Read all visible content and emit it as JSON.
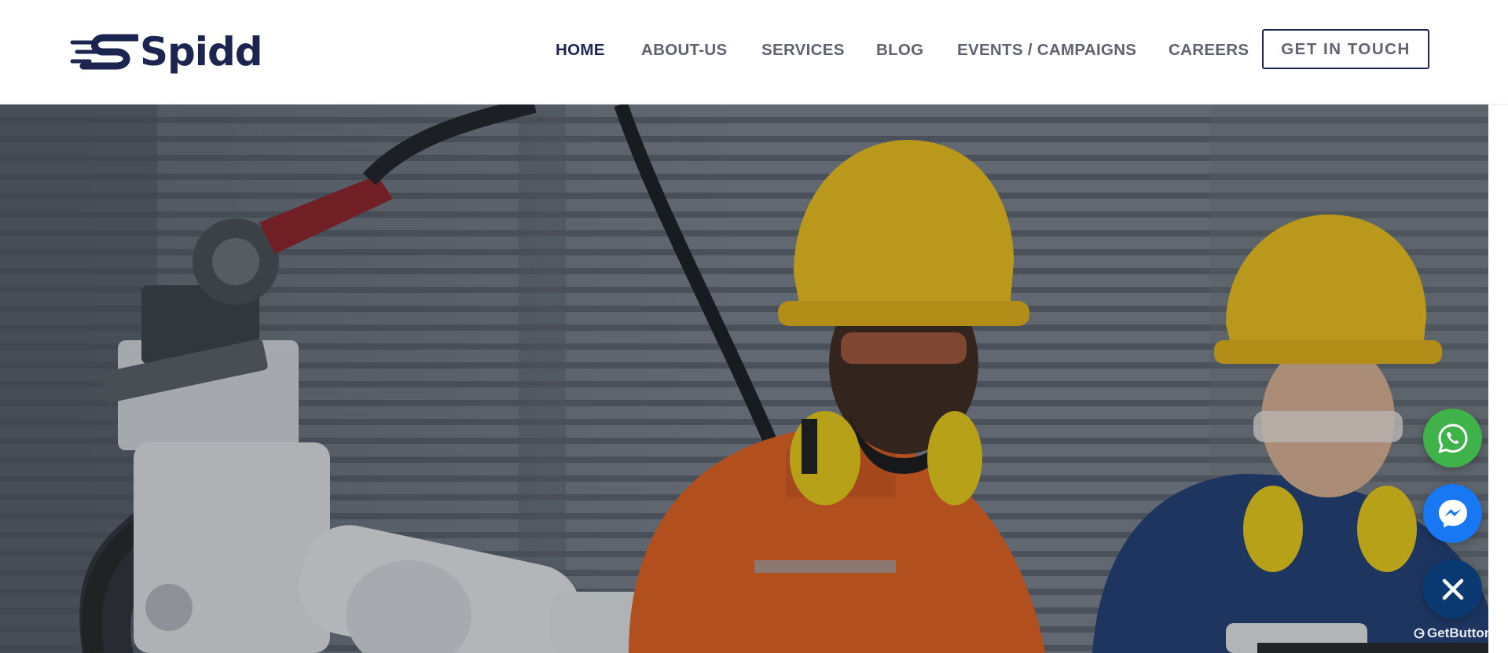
{
  "brand": {
    "name": "Spidd",
    "logo_icon": "speed-s-icon",
    "color": "#1b2550"
  },
  "nav": {
    "items": [
      {
        "label": "HOME",
        "active": true
      },
      {
        "label": "ABOUT-US",
        "active": false
      },
      {
        "label": "SERVICES",
        "active": false
      },
      {
        "label": "BLOG",
        "active": false
      },
      {
        "label": "EVENTS / CAMPAIGNS",
        "active": false
      },
      {
        "label": "CAREERS",
        "active": false
      }
    ],
    "cta_label": "GET IN TOUCH"
  },
  "hero": {
    "image_subject": "industrial robot arm with engineers in hard hats"
  },
  "floating_buttons": [
    {
      "icon": "whatsapp-icon",
      "color": "#3fb34a"
    },
    {
      "icon": "messenger-icon",
      "color": "#1877f2"
    },
    {
      "icon": "close-icon",
      "color": "#0b3a73"
    }
  ],
  "widget_credit": "GetButton",
  "colors": {
    "nav_text": "#5f6370",
    "nav_active": "#1b2550",
    "cta_border": "#1b2550"
  }
}
